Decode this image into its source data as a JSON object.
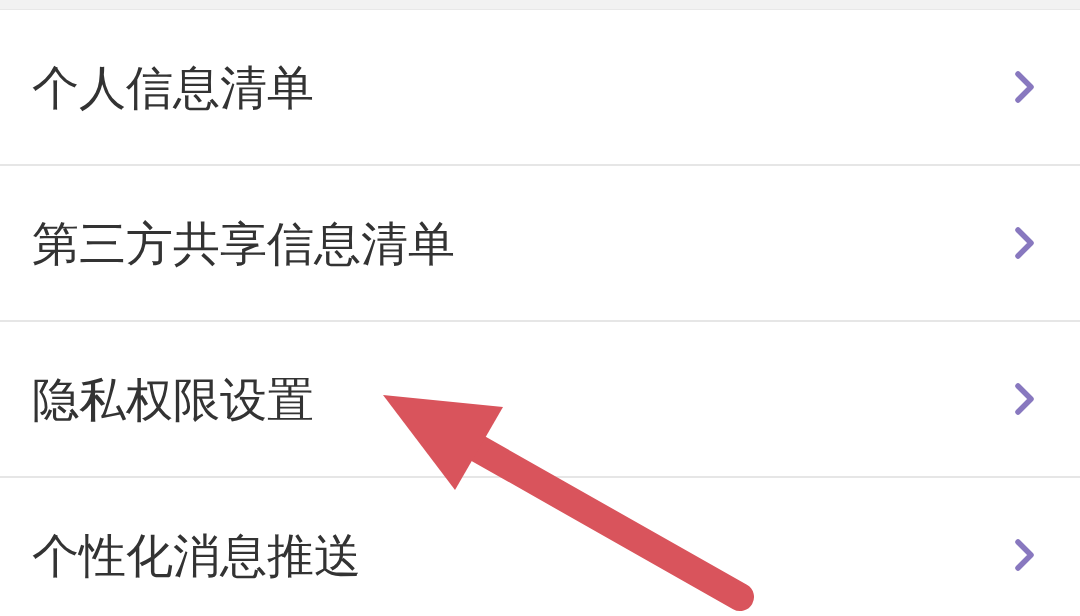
{
  "menu": {
    "items": [
      {
        "label": "个人信息清单"
      },
      {
        "label": "第三方共享信息清单"
      },
      {
        "label": "隐私权限设置"
      },
      {
        "label": "个性化消息推送"
      }
    ]
  }
}
